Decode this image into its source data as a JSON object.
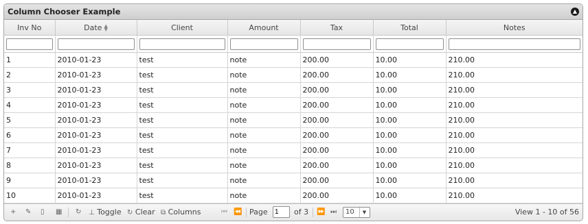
{
  "caption": {
    "title": "Column Chooser Example",
    "collapse_icon": "chevron-up-icon"
  },
  "columns": [
    {
      "key": "inv_no",
      "label": "Inv No"
    },
    {
      "key": "date",
      "label": "Date",
      "sortable": true
    },
    {
      "key": "client",
      "label": "Client"
    },
    {
      "key": "amount",
      "label": "Amount"
    },
    {
      "key": "tax",
      "label": "Tax"
    },
    {
      "key": "total",
      "label": "Total"
    },
    {
      "key": "notes",
      "label": "Notes"
    }
  ],
  "rows": [
    [
      "1",
      "2010-01-23",
      "test",
      "note",
      "200.00",
      "10.00",
      "210.00"
    ],
    [
      "2",
      "2010-01-23",
      "test",
      "note",
      "200.00",
      "10.00",
      "210.00"
    ],
    [
      "3",
      "2010-01-23",
      "test",
      "note",
      "200.00",
      "10.00",
      "210.00"
    ],
    [
      "4",
      "2010-01-23",
      "test",
      "note",
      "200.00",
      "10.00",
      "210.00"
    ],
    [
      "5",
      "2010-01-23",
      "test",
      "note",
      "200.00",
      "10.00",
      "210.00"
    ],
    [
      "6",
      "2010-01-23",
      "test",
      "note",
      "200.00",
      "10.00",
      "210.00"
    ],
    [
      "7",
      "2010-01-23",
      "test",
      "note",
      "200.00",
      "10.00",
      "210.00"
    ],
    [
      "8",
      "2010-01-23",
      "test",
      "note",
      "200.00",
      "10.00",
      "210.00"
    ],
    [
      "9",
      "2010-01-23",
      "test",
      "note",
      "200.00",
      "10.00",
      "210.00"
    ],
    [
      "10",
      "2010-01-23",
      "test",
      "note",
      "200.00",
      "10.00",
      "210.00"
    ]
  ],
  "pager": {
    "actions": [
      {
        "name": "add-icon",
        "glyph": "+"
      },
      {
        "name": "edit-icon",
        "glyph": "✎"
      },
      {
        "name": "view-icon",
        "glyph": "🗋"
      },
      {
        "name": "delete-icon",
        "glyph": "🗑"
      },
      {
        "name": "refresh-icon",
        "glyph": "↻"
      }
    ],
    "toggle_label": "Toggle",
    "clear_label": "Clear",
    "columns_label": "Columns",
    "first_glyph": "⏮",
    "prev_glyph": "⏪",
    "next_glyph": "⏩",
    "last_glyph": "⏭",
    "page_label": "Page",
    "page_value": "1",
    "of_label": "of 3",
    "rows_per_page": "10",
    "view_text": "View 1 - 10 of 56"
  }
}
